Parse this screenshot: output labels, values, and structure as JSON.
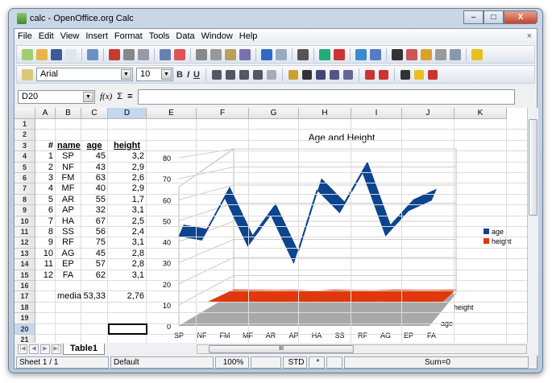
{
  "window": {
    "title": "calc - OpenOffice.org Calc",
    "minimize": "–",
    "maximize": "□",
    "close": "X"
  },
  "menu": [
    "File",
    "Edit",
    "View",
    "Insert",
    "Format",
    "Tools",
    "Data",
    "Window",
    "Help"
  ],
  "menu_close": "×",
  "toolbar1": [
    "new-icon",
    "open-icon",
    "save-icon",
    "email-icon",
    "edit-mode-icon",
    "export-pdf-icon",
    "print-icon",
    "page-preview-icon",
    "spellcheck-icon",
    "autospellcheck-icon",
    "cut-icon",
    "copy-icon",
    "paste-icon",
    "format-paintbrush-icon",
    "undo-icon",
    "redo-icon",
    "hyperlink-icon",
    "sort-ascending-icon",
    "sort-descending-icon",
    "chart-icon",
    "draw-functions-icon",
    "find-replace-icon",
    "navigator-icon",
    "gallery-icon",
    "datasources-icon",
    "zoom-icon",
    "help-icon"
  ],
  "toolbar2": {
    "styles_icon": "styles-icon",
    "font": "Arial",
    "size": "10",
    "buttons": [
      "bold-icon",
      "italic-icon",
      "underline-icon",
      "align-left-icon",
      "align-center-icon",
      "align-right-icon",
      "justify-icon",
      "merge-cells-icon",
      "currency-icon",
      "percent-icon",
      "standard-format-icon",
      "add-decimal-icon",
      "delete-decimal-icon",
      "decrease-indent-icon",
      "increase-indent-icon",
      "borders-icon",
      "background-color-icon",
      "font-color-icon"
    ],
    "bold": "B",
    "italic": "I",
    "underline": "U"
  },
  "formula": {
    "cell_ref": "D20",
    "fx": "f(x)",
    "sum": "Σ",
    "equals": "=",
    "value": ""
  },
  "columns": [
    "A",
    "B",
    "C",
    "D",
    "E",
    "F",
    "G",
    "H",
    "I",
    "J",
    "K"
  ],
  "rows": [
    "1",
    "2",
    "3",
    "4",
    "5",
    "6",
    "7",
    "8",
    "9",
    "10",
    "11",
    "12",
    "13",
    "14",
    "15",
    "16",
    "17",
    "18",
    "19",
    "20",
    "21"
  ],
  "table": {
    "headers": [
      "#",
      "name",
      "age",
      "height"
    ],
    "rows": [
      [
        "1",
        "SP",
        "45",
        "3,2"
      ],
      [
        "2",
        "NF",
        "43",
        "2,9"
      ],
      [
        "3",
        "FM",
        "63",
        "2,6"
      ],
      [
        "4",
        "MF",
        "40",
        "2,9"
      ],
      [
        "5",
        "AR",
        "55",
        "1,7"
      ],
      [
        "6",
        "AP",
        "32",
        "3,1"
      ],
      [
        "7",
        "HA",
        "67",
        "2,5"
      ],
      [
        "8",
        "SS",
        "56",
        "2,4"
      ],
      [
        "9",
        "RF",
        "75",
        "3,1"
      ],
      [
        "10",
        "AG",
        "45",
        "2,8"
      ],
      [
        "11",
        "EP",
        "57",
        "2,8"
      ],
      [
        "12",
        "FA",
        "62",
        "3,1"
      ]
    ],
    "summary": {
      "label": "media",
      "age": "53,33",
      "height": "2,76"
    }
  },
  "chart_data": {
    "type": "line",
    "subtype": "3d-ribbon",
    "title": "Age and Height",
    "categories": [
      "SP",
      "NF",
      "FM",
      "MF",
      "AR",
      "AP",
      "HA",
      "SS",
      "RF",
      "AG",
      "EP",
      "FA"
    ],
    "series": [
      {
        "name": "age",
        "color": "#0b4590",
        "values": [
          45,
          43,
          63,
          40,
          55,
          32,
          67,
          56,
          75,
          45,
          57,
          62
        ]
      },
      {
        "name": "height",
        "color": "#e0380b",
        "values": [
          3.2,
          2.9,
          2.6,
          2.9,
          1.7,
          3.1,
          2.5,
          2.4,
          3.1,
          2.8,
          2.8,
          3.1
        ]
      }
    ],
    "depth_labels": [
      "height",
      "age"
    ],
    "yticks": [
      "0",
      "10",
      "20",
      "30",
      "40",
      "50",
      "60",
      "70",
      "80"
    ],
    "ylim": [
      0,
      80
    ],
    "grid": true,
    "legend": "right"
  },
  "tabs": {
    "sheet": "Table1",
    "scroll_mark": "III"
  },
  "status": {
    "sheet": "Sheet 1 / 1",
    "style": "Default",
    "zoom": "100%",
    "blank1": "",
    "mode": "STD",
    "modified": "*",
    "blank2": "",
    "sum": "Sum=0"
  }
}
